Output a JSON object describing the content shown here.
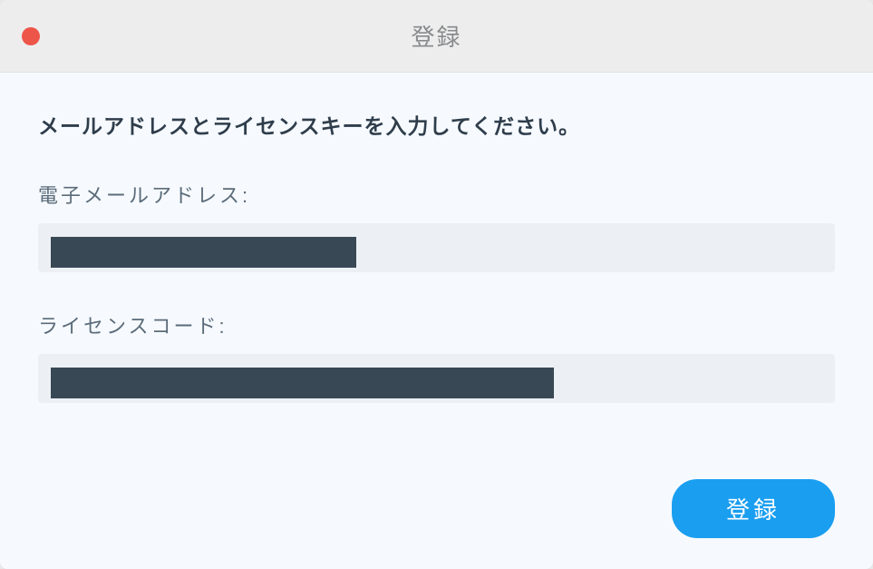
{
  "titlebar": {
    "title": "登録"
  },
  "form": {
    "instruction": "メールアドレスとライセンスキーを入力してください。",
    "email": {
      "label": "電子メールアドレス:",
      "value": ""
    },
    "license": {
      "label": "ライセンスコード:",
      "value": ""
    }
  },
  "actions": {
    "register_label": "登録"
  }
}
